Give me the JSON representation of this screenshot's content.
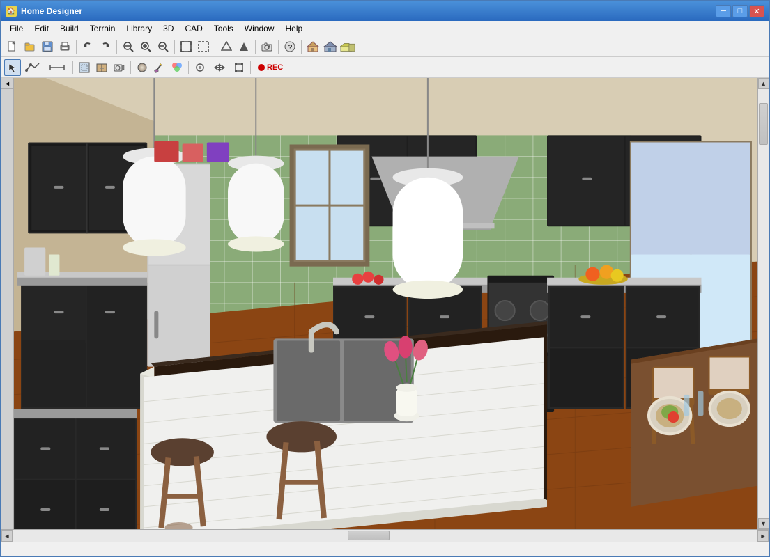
{
  "window": {
    "title": "Home Designer",
    "icon": "🏠"
  },
  "title_controls": {
    "minimize": "─",
    "maximize": "□",
    "close": "✕"
  },
  "menu": {
    "items": [
      "File",
      "Edit",
      "Build",
      "Terrain",
      "Library",
      "3D",
      "CAD",
      "Tools",
      "Window",
      "Help"
    ]
  },
  "toolbar1": {
    "buttons": [
      {
        "name": "new",
        "icon": "📄"
      },
      {
        "name": "open",
        "icon": "📂"
      },
      {
        "name": "save",
        "icon": "💾"
      },
      {
        "name": "print",
        "icon": "🖨"
      },
      {
        "name": "undo",
        "icon": "↩"
      },
      {
        "name": "redo",
        "icon": "↪"
      },
      {
        "name": "zoom-fit",
        "icon": "⊙"
      },
      {
        "name": "zoom-in",
        "icon": "🔍"
      },
      {
        "name": "zoom-out",
        "icon": "🔍"
      },
      {
        "name": "fill",
        "icon": "⬜"
      },
      {
        "name": "select-all",
        "icon": "⬛"
      },
      {
        "name": "tool1",
        "icon": "↕"
      },
      {
        "name": "camera",
        "icon": "📷"
      },
      {
        "name": "help",
        "icon": "?"
      },
      {
        "name": "house1",
        "icon": "🏠"
      },
      {
        "name": "house2",
        "icon": "🏡"
      },
      {
        "name": "house3",
        "icon": "🏘"
      }
    ]
  },
  "toolbar2": {
    "buttons": [
      {
        "name": "select",
        "icon": "↖",
        "wide": false
      },
      {
        "name": "polyline",
        "icon": "⌐",
        "wide": true
      },
      {
        "name": "dimension",
        "icon": "↔",
        "wide": true
      },
      {
        "name": "fill2",
        "icon": "▦",
        "wide": false
      },
      {
        "name": "stairs",
        "icon": "⌂",
        "wide": false
      },
      {
        "name": "camera2",
        "icon": "⊡",
        "wide": false
      },
      {
        "name": "material",
        "icon": "◈",
        "wide": false
      },
      {
        "name": "paint",
        "icon": "✏",
        "wide": false
      },
      {
        "name": "color",
        "icon": "🎨",
        "wide": false
      },
      {
        "name": "spray",
        "icon": "◎",
        "wide": false
      },
      {
        "name": "move",
        "icon": "✥",
        "wide": false
      },
      {
        "name": "transform",
        "icon": "⊕",
        "wide": false
      },
      {
        "name": "record",
        "icon": "⏺",
        "wide": true
      }
    ]
  },
  "scene": {
    "description": "3D kitchen interior render"
  },
  "scrollbar": {
    "up_arrow": "▲",
    "down_arrow": "▼",
    "left_arrow": "◄",
    "right_arrow": "►"
  },
  "status_bar": {
    "text": ""
  }
}
